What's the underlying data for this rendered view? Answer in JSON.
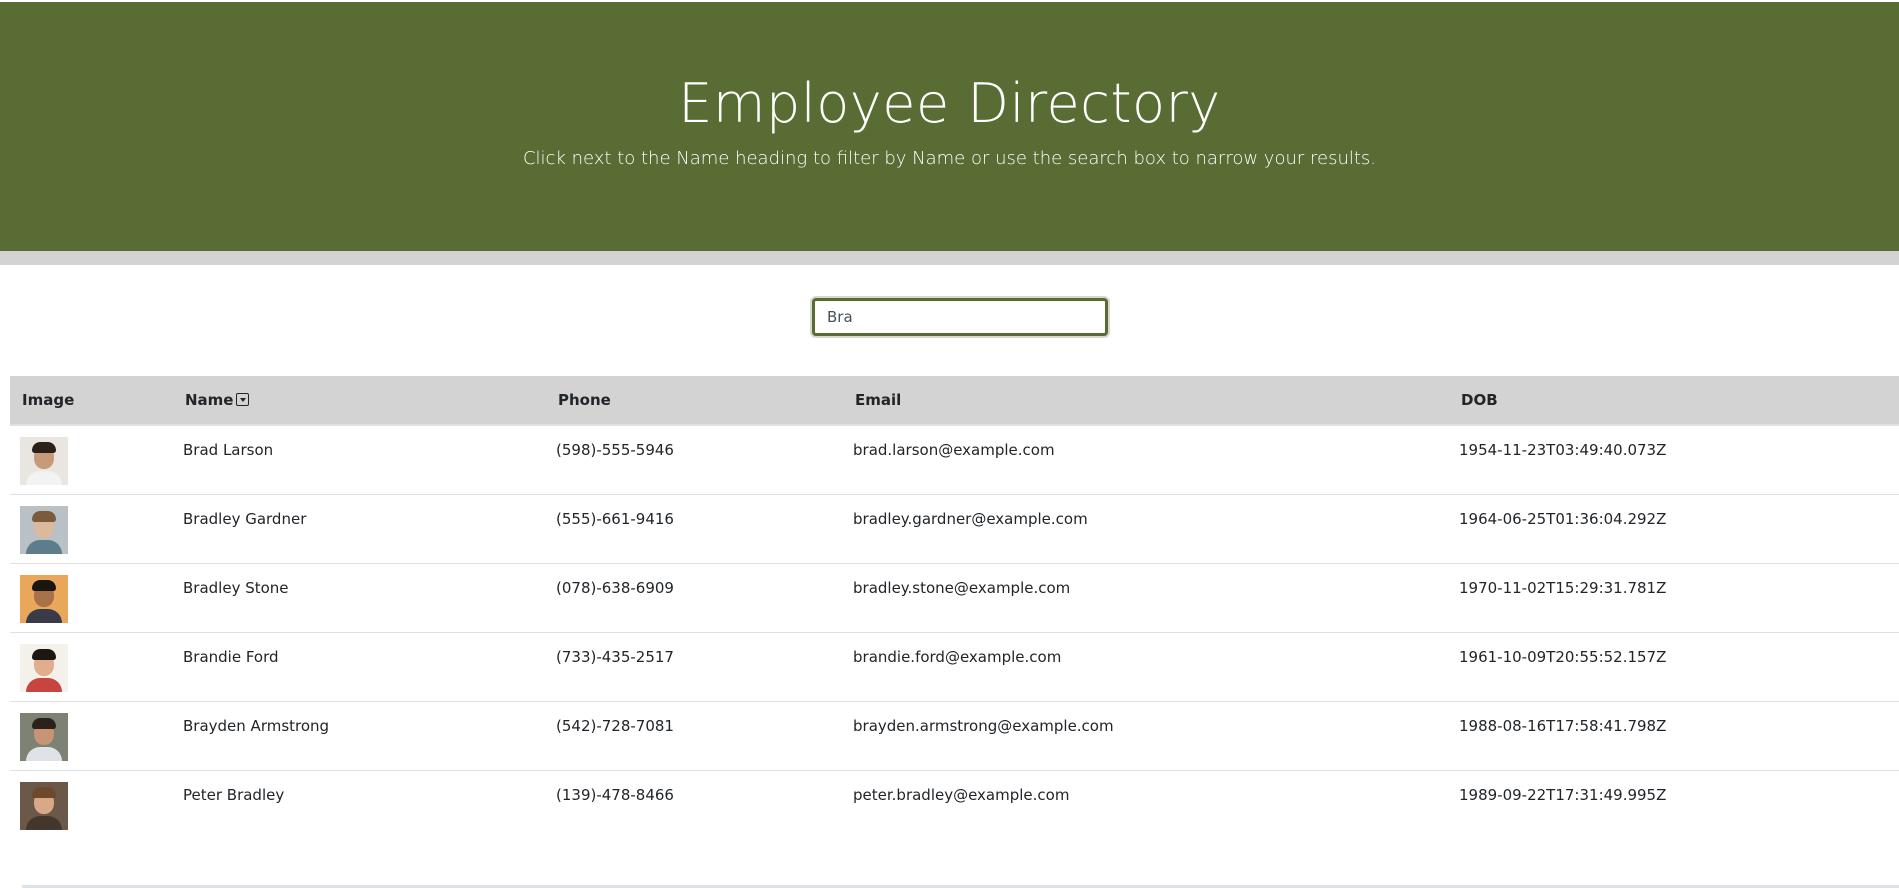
{
  "header": {
    "title": "Employee Directory",
    "subtitle": "Click next to the Name heading to filter by Name or use the search box to narrow your results."
  },
  "search": {
    "value": "Bra"
  },
  "table": {
    "columns": {
      "image": "Image",
      "name": "Name",
      "phone": "Phone",
      "email": "Email",
      "dob": "DOB"
    },
    "rows": [
      {
        "name": "Brad  Larson",
        "phone": "(598)-555-5946",
        "email": "brad.larson@example.com",
        "dob": "1954-11-23T03:49:40.073Z"
      },
      {
        "name": "Bradley  Gardner",
        "phone": "(555)-661-9416",
        "email": "bradley.gardner@example.com",
        "dob": "1964-06-25T01:36:04.292Z"
      },
      {
        "name": "Bradley  Stone",
        "phone": "(078)-638-6909",
        "email": "bradley.stone@example.com",
        "dob": "1970-11-02T15:29:31.781Z"
      },
      {
        "name": "Brandie  Ford",
        "phone": "(733)-435-2517",
        "email": "brandie.ford@example.com",
        "dob": "1961-10-09T20:55:52.157Z"
      },
      {
        "name": "Brayden  Armstrong",
        "phone": "(542)-728-7081",
        "email": "brayden.armstrong@example.com",
        "dob": "1988-08-16T17:58:41.798Z"
      },
      {
        "name": "Peter  Bradley",
        "phone": "(139)-478-8466",
        "email": "peter.bradley@example.com",
        "dob": "1989-09-22T17:31:49.995Z"
      }
    ]
  },
  "colors": {
    "header_bg": "#586c33",
    "table_header_bg": "#d3d3d3",
    "accent_border": "#586c33"
  },
  "icons": {
    "sort": "sort-dropdown-icon"
  }
}
